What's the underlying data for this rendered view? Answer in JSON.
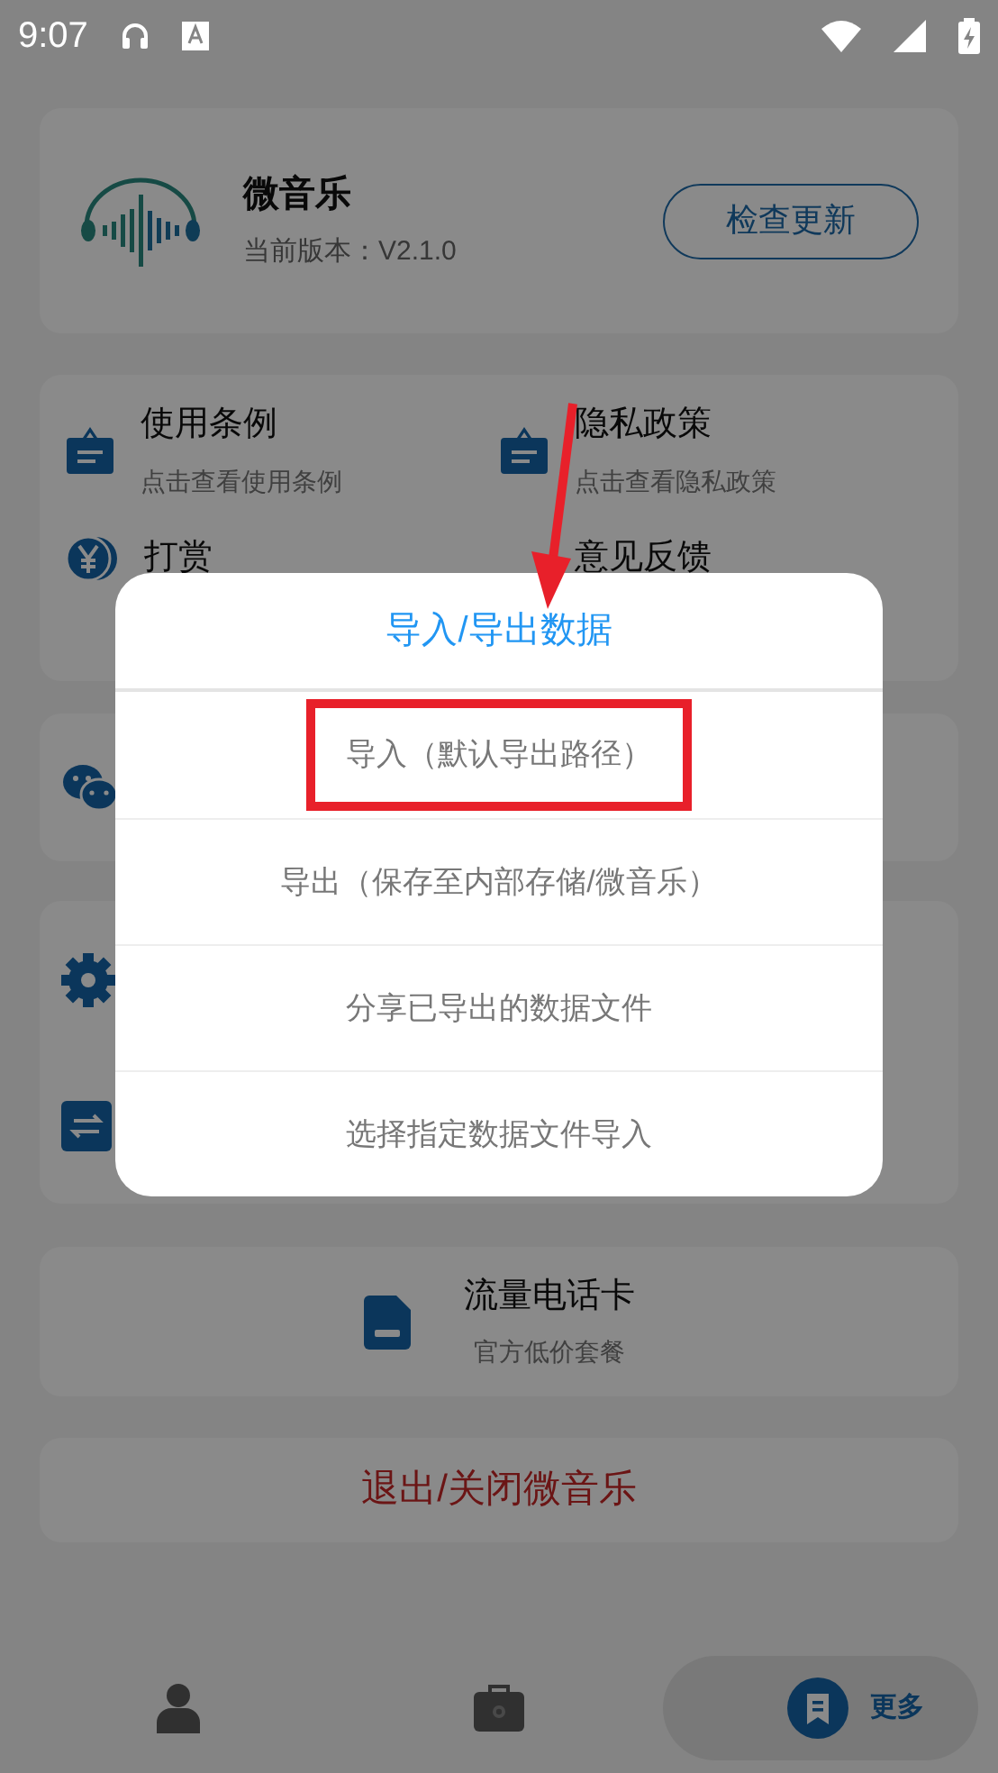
{
  "status_bar": {
    "time": "9:07"
  },
  "app": {
    "name": "微音乐",
    "version": "当前版本：V2.1.0",
    "update_button": "检查更新"
  },
  "links": [
    {
      "title": "使用条例",
      "subtitle": "点击查看使用条例",
      "kind": "notice"
    },
    {
      "title": "隐私政策",
      "subtitle": "点击查看隐私政策",
      "kind": "notice"
    },
    {
      "title": "打赏",
      "kind": "coin"
    },
    {
      "title": "意见反馈",
      "kind": "none"
    }
  ],
  "promo": {
    "title": "流量电话卡",
    "subtitle": "官方低价套餐"
  },
  "exit_button": "退出/关闭微音乐",
  "dialog": {
    "title": "导入/导出数据",
    "options": [
      {
        "label": "导入（默认导出路径）",
        "highlighted": true
      },
      {
        "label": "导出（保存至内部存储/微音乐）",
        "highlighted": false
      },
      {
        "label": "分享已导出的数据文件",
        "highlighted": false
      },
      {
        "label": "选择指定数据文件导入",
        "highlighted": false
      }
    ]
  },
  "nav": [
    {
      "kind": "profile",
      "selected": false
    },
    {
      "kind": "toolbox",
      "selected": false
    },
    {
      "kind": "more",
      "label": "更多",
      "selected": true
    }
  ]
}
